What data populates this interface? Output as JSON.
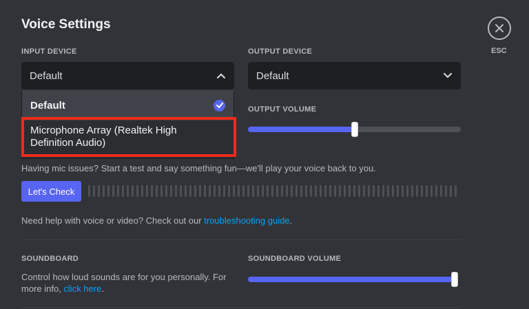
{
  "title": "Voice Settings",
  "input_device": {
    "label": "INPUT DEVICE",
    "selected": "Default",
    "options": [
      "Default",
      "Microphone Array (Realtek High Definition Audio)"
    ],
    "option_lines": [
      "Microphone Array (Realtek High",
      "Definition Audio)"
    ]
  },
  "output_device": {
    "label": "OUTPUT DEVICE",
    "selected": "Default"
  },
  "output_volume": {
    "label": "OUTPUT VOLUME",
    "value_fraction": 0.5
  },
  "mic_test": {
    "text": "Having mic issues? Start a test and say something fun—we'll play your voice back to you.",
    "button_label": "Let's Check"
  },
  "help": {
    "prefix": "Need help with voice or video? Check out our ",
    "link": "troubleshooting guide",
    "suffix": "."
  },
  "soundboard": {
    "label": "SOUNDBOARD",
    "text_line1": "Control how loud sounds are for you personally. For",
    "text_line2_prefix": "more info, ",
    "link": "click here",
    "text_suffix": "."
  },
  "soundboard_volume": {
    "label": "SOUNDBOARD VOLUME",
    "value_fraction": 1.0
  },
  "close": {
    "label": "ESC"
  },
  "colors": {
    "accent": "#5865f2",
    "highlight": "#ee2b1a",
    "link": "#00a8fc"
  }
}
